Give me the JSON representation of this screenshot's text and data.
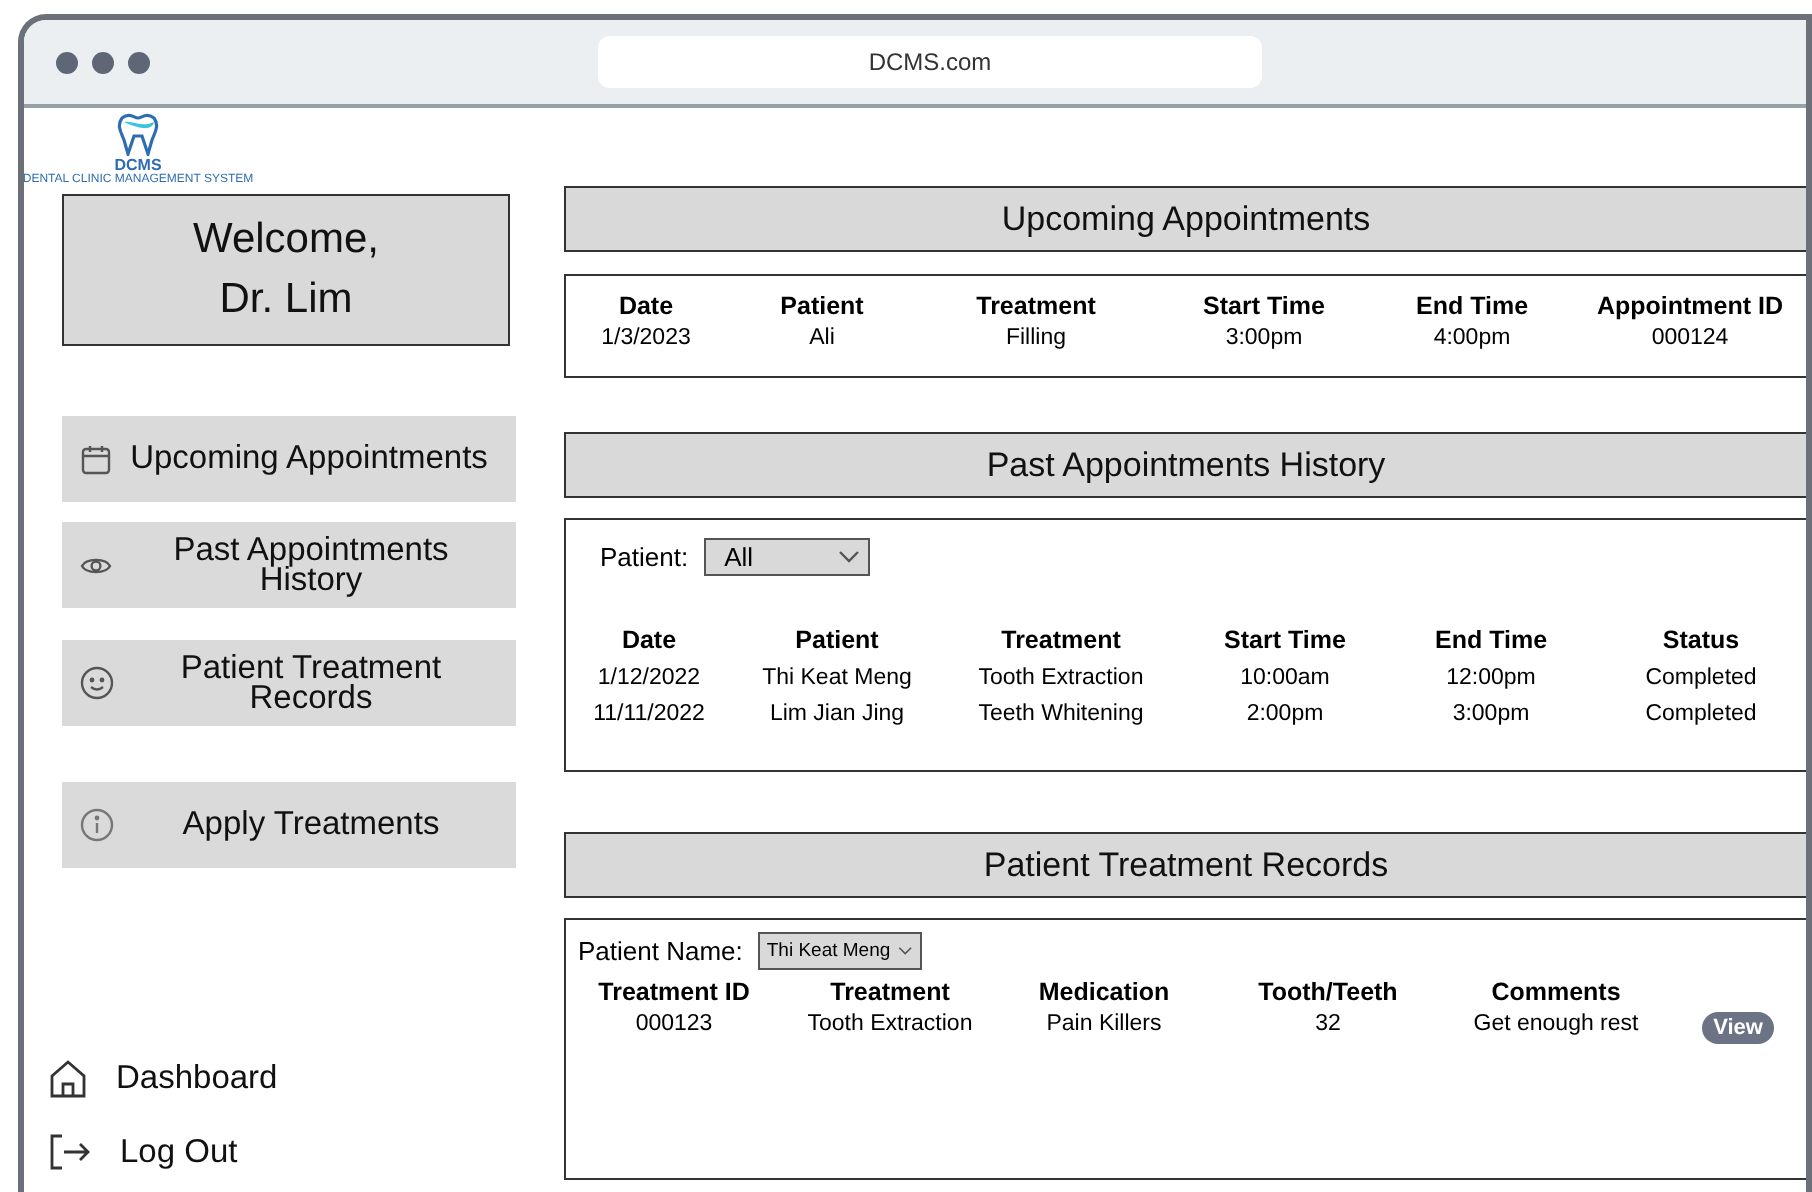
{
  "window": {
    "address": "DCMS.com"
  },
  "logo": {
    "name": "DCMS",
    "tagline": "DENTAL CLINIC MANAGEMENT SYSTEM"
  },
  "welcome": {
    "lines": [
      "Welcome,",
      "Dr. Lim"
    ]
  },
  "sidebar": {
    "items": [
      {
        "label": "Upcoming Appointments",
        "kind": "calendar"
      },
      {
        "label": "Past Appointments History",
        "kind": "eye"
      },
      {
        "label": "Patient Treatment Records",
        "kind": "smiley"
      },
      {
        "label": "Apply Treatments",
        "kind": "info"
      }
    ],
    "footer": [
      {
        "label": "Dashboard",
        "kind": "home"
      },
      {
        "label": "Log Out",
        "kind": "logout"
      }
    ]
  },
  "sections": [
    {
      "title": "Upcoming Appointments",
      "columns": [
        "Date",
        "Patient",
        "Treatment",
        "Start Time",
        "End Time",
        "Appointment ID"
      ],
      "rows": [
        {
          "cells": [
            "1/3/2023",
            "Ali",
            "Filling",
            "3:00pm",
            "4:00pm",
            "000124"
          ]
        }
      ]
    },
    {
      "title": "Past Appointments History",
      "filter": {
        "label": "Patient:",
        "value": "All"
      },
      "columns": [
        "Date",
        "Patient",
        "Treatment",
        "Start Time",
        "End Time",
        "Status"
      ],
      "rows": [
        {
          "cells": [
            "1/12/2022",
            "Thi Keat Meng",
            "Tooth Extraction",
            "10:00am",
            "12:00pm",
            "Completed"
          ]
        },
        {
          "cells": [
            "11/11/2022",
            "Lim Jian Jing",
            "Teeth Whitening",
            "2:00pm",
            "3:00pm",
            "Completed"
          ]
        }
      ]
    },
    {
      "title": "Patient Treatment Records",
      "filter": {
        "label": "Patient Name:",
        "value": "Thi Keat Meng"
      },
      "columns": [
        "Treatment ID",
        "Treatment",
        "Medication",
        "Tooth/Teeth",
        "Comments"
      ],
      "rows": [
        {
          "cells": [
            "000123",
            "Tooth Extraction",
            "Pain Killers",
            "32",
            "Get enough rest"
          ],
          "action": "View"
        }
      ]
    }
  ]
}
